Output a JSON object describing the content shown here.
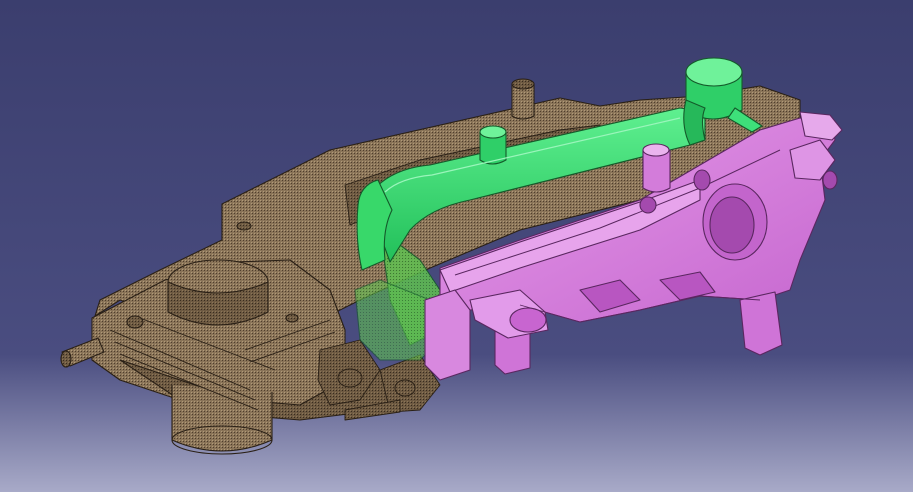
{
  "viewer": {
    "background": {
      "top_color": "#3b3e6e",
      "mid_color": "#4a4d80",
      "bottom_color": "#a8aac8"
    },
    "parts": [
      {
        "name": "casting-body",
        "color": "#8a7458",
        "edge_color": "#2a2016",
        "render": "transparent-hatched"
      },
      {
        "name": "runner-channel",
        "color": "#3ee07a",
        "edge_color": "#145a2a",
        "render": "shaded"
      },
      {
        "name": "core-insert",
        "color": "#d97ee0",
        "edge_color": "#5a2760",
        "render": "shaded"
      }
    ]
  }
}
